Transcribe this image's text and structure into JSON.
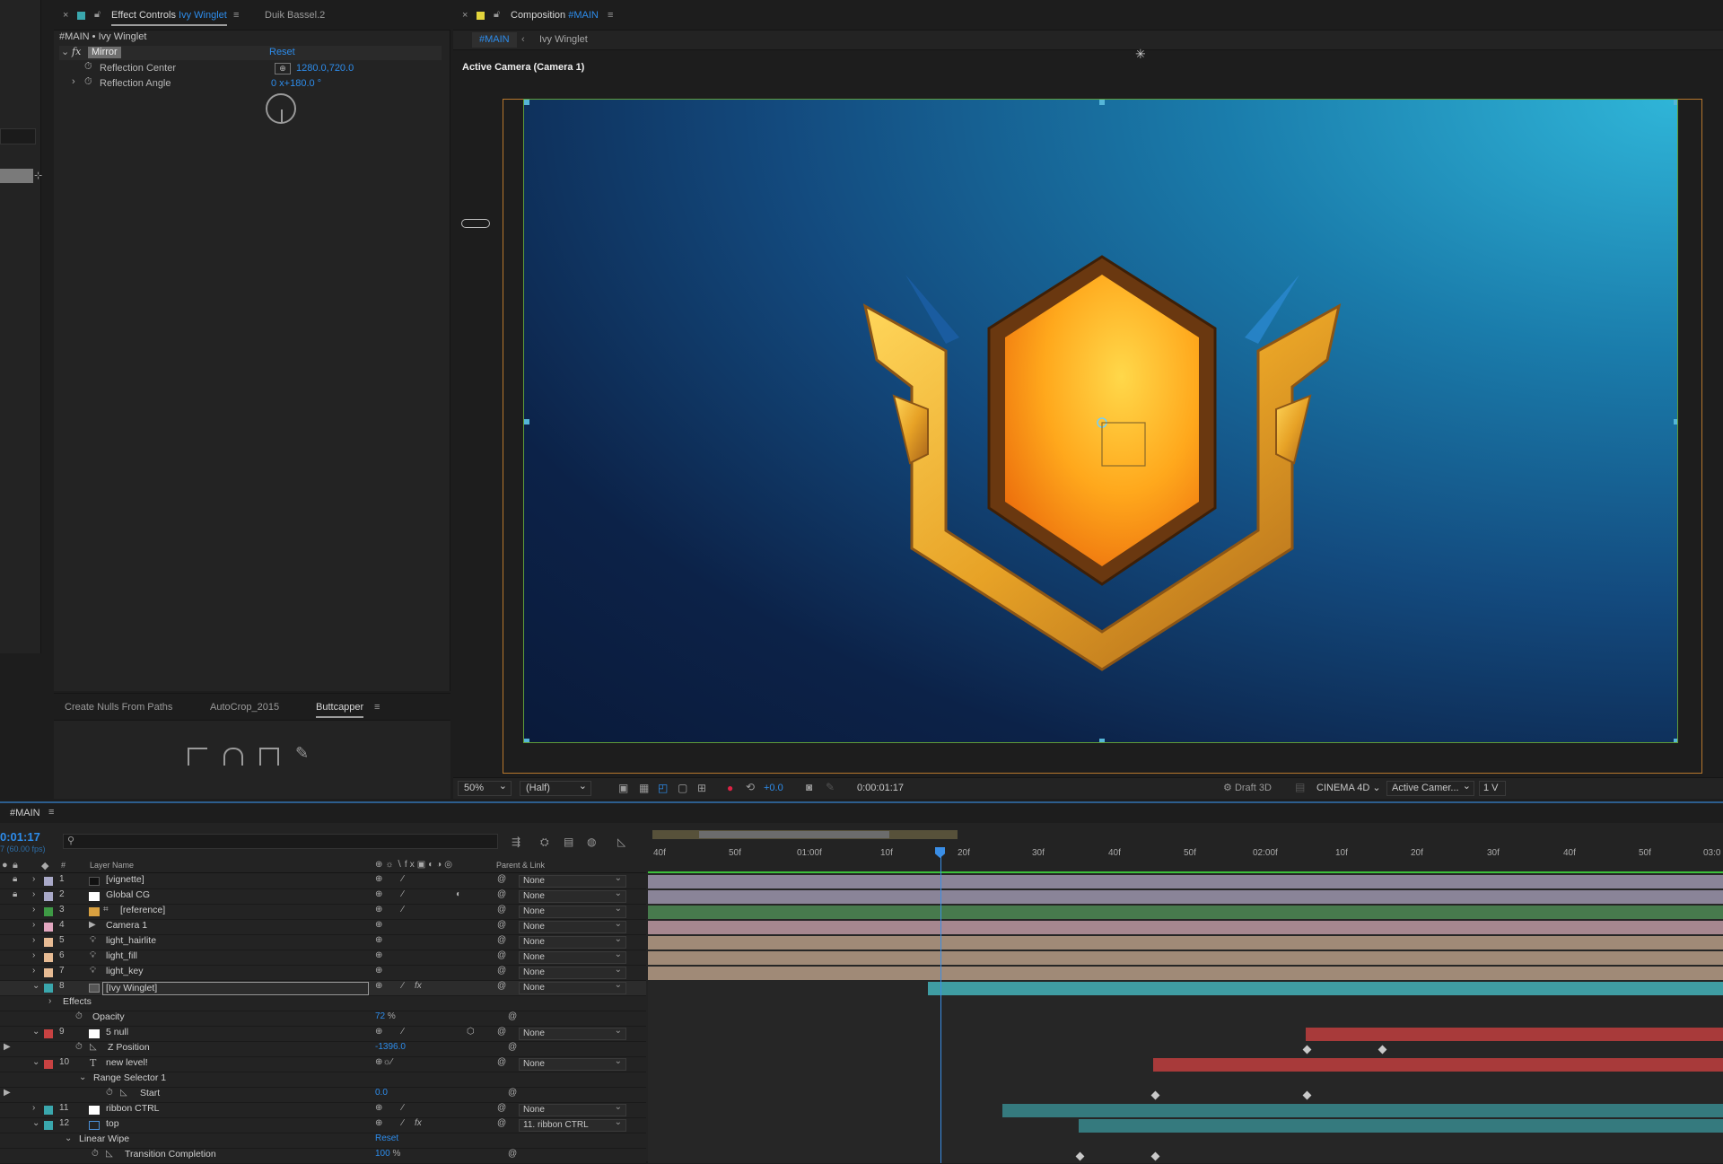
{
  "effect_controls": {
    "tab_label": "Effect Controls",
    "tab_layer": "Ivy Winglet",
    "tab2": "Duik Bassel.2",
    "breadcrumb": "#MAIN • Ivy Winglet",
    "effect_name": "Mirror",
    "reset": "Reset",
    "props": [
      {
        "label": "Reflection Center",
        "value": "1280.0,720.0"
      },
      {
        "label": "Reflection Angle",
        "value": "0 x+180.0 °"
      }
    ]
  },
  "scripts_panel": {
    "tabs": [
      "Create Nulls From Paths",
      "AutoCrop_2015",
      "Buttcapper"
    ],
    "active_tab": "Buttcapper"
  },
  "composition": {
    "tab_label": "Composition",
    "tab_comp": "#MAIN",
    "crumbs": [
      "#MAIN",
      "Ivy Winglet"
    ],
    "camera_label": "Active Camera (Camera 1)",
    "footer": {
      "zoom": "50%",
      "resolution": "(Half)",
      "exposure": "+0.0",
      "timecode": "0:00:01:17",
      "renderer_mode": "Draft 3D",
      "renderer": "CINEMA 4D",
      "view": "Active Camer...",
      "views_count": "1 V"
    }
  },
  "timeline": {
    "tab": "#MAIN",
    "timecode": "0:01:17",
    "fps": "7 (60.00 fps)",
    "search_placeholder": "",
    "header": {
      "layer_name": "Layer Name",
      "parent_link": "Parent & Link",
      "num": "#"
    },
    "ruler": [
      "40f",
      "50f",
      "01:00f",
      "10f",
      "20f",
      "30f",
      "40f",
      "50f",
      "02:00f",
      "10f",
      "20f",
      "30f",
      "40f",
      "50f",
      "03:0"
    ],
    "rows": [
      {
        "num": "1",
        "name": "[vignette]",
        "parent": "None"
      },
      {
        "num": "2",
        "name": "Global CG",
        "parent": "None"
      },
      {
        "num": "3",
        "name": "[reference]",
        "parent": "None"
      },
      {
        "num": "4",
        "name": "Camera 1",
        "parent": "None"
      },
      {
        "num": "5",
        "name": "light_hairlite",
        "parent": "None"
      },
      {
        "num": "6",
        "name": "light_fill",
        "parent": "None"
      },
      {
        "num": "7",
        "name": "light_key",
        "parent": "None"
      },
      {
        "num": "8",
        "name": "[Ivy Winglet]",
        "parent": "None"
      },
      {
        "num": "9",
        "name": "5 null",
        "parent": "None"
      },
      {
        "num": "10",
        "name": "new level!",
        "parent": "None"
      },
      {
        "num": "11",
        "name": "ribbon CTRL",
        "parent": "None"
      },
      {
        "num": "12",
        "name": "top",
        "parent": "11. ribbon CTRL"
      }
    ],
    "sub": {
      "effects": "Effects",
      "opacity": "Opacity",
      "opacity_val": "72",
      "opacity_unit": "%",
      "zpos": "Z Position",
      "zpos_val": "-1396.0",
      "range": "Range Selector 1",
      "start": "Start",
      "start_val": "0.0",
      "wipe": "Linear Wipe",
      "wipe_reset": "Reset",
      "trans": "Transition Completion",
      "trans_val": "100",
      "trans_unit": "%"
    }
  },
  "colors": {
    "accent": "#2d8ceb",
    "playhead": "#3a8ee6"
  }
}
